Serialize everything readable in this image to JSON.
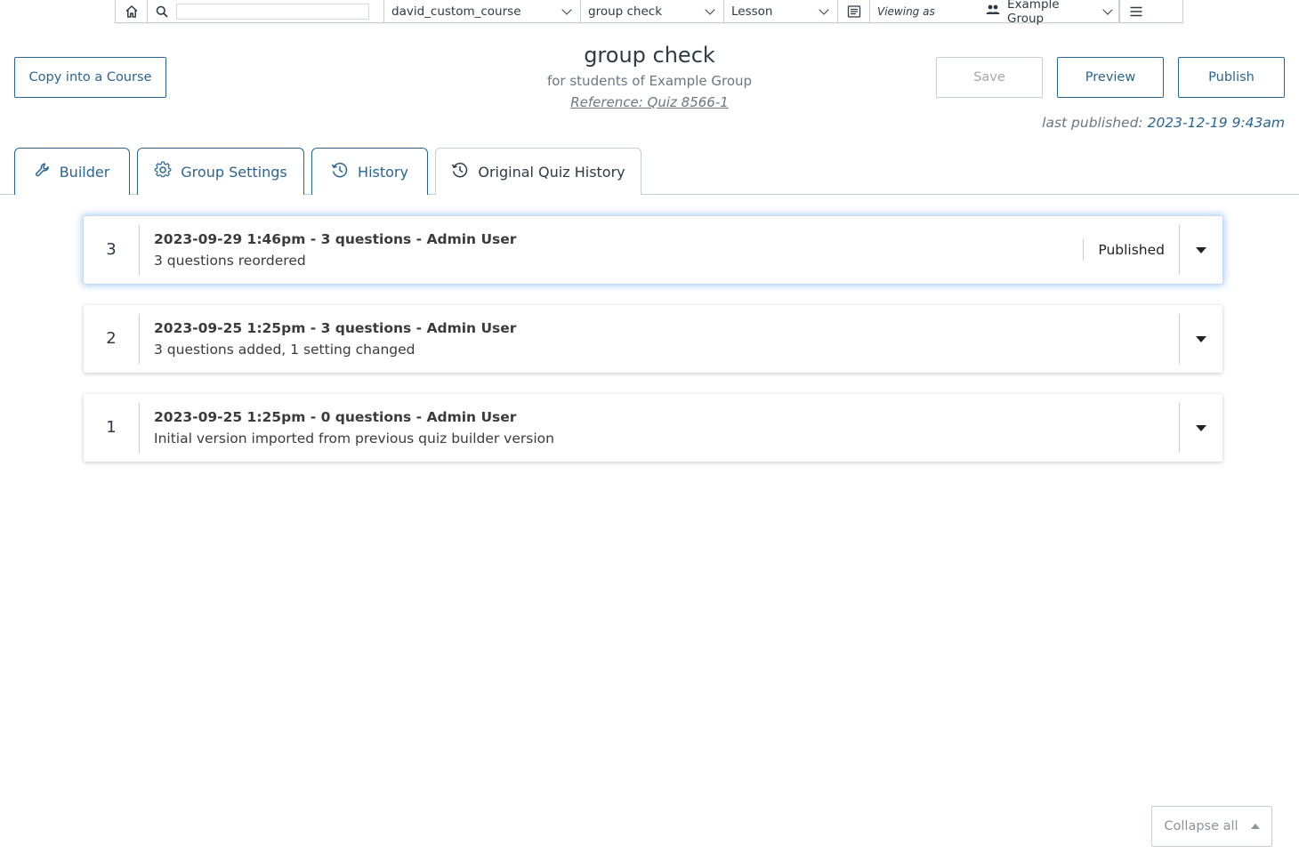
{
  "toolbar": {
    "search_placeholder": "",
    "course": "david_custom_course",
    "quiz": "group check",
    "type": "Lesson",
    "viewing_as_label": "Viewing as",
    "group": "Example Group"
  },
  "header": {
    "copy_button": "Copy into a Course",
    "title": "group check",
    "subtitle": "for students of Example Group",
    "reference": "Reference: Quiz 8566-1",
    "save_button": "Save",
    "preview_button": "Preview",
    "publish_button": "Publish",
    "last_published_label": "last published:",
    "last_published_date": "2023-12-19 9:43am"
  },
  "tabs": [
    {
      "label": "Builder"
    },
    {
      "label": "Group Settings"
    },
    {
      "label": "History"
    },
    {
      "label": "Original Quiz History"
    }
  ],
  "versions": [
    {
      "number": "3",
      "heading": "2023-09-29 1:46pm - 3 questions - Admin User",
      "description": "3 questions reordered",
      "status": "Published"
    },
    {
      "number": "2",
      "heading": "2023-09-25 1:25pm - 3 questions - Admin User",
      "description": "3 questions added, 1 setting changed",
      "status": ""
    },
    {
      "number": "1",
      "heading": "2023-09-25 1:25pm - 0 questions - Admin User",
      "description": "Initial version imported from previous quiz builder version",
      "status": ""
    }
  ],
  "collapse_all_label": "Collapse all",
  "colors": {
    "accent": "#2a6592",
    "border": "#c7cdd1",
    "text": "#2d3b45"
  }
}
